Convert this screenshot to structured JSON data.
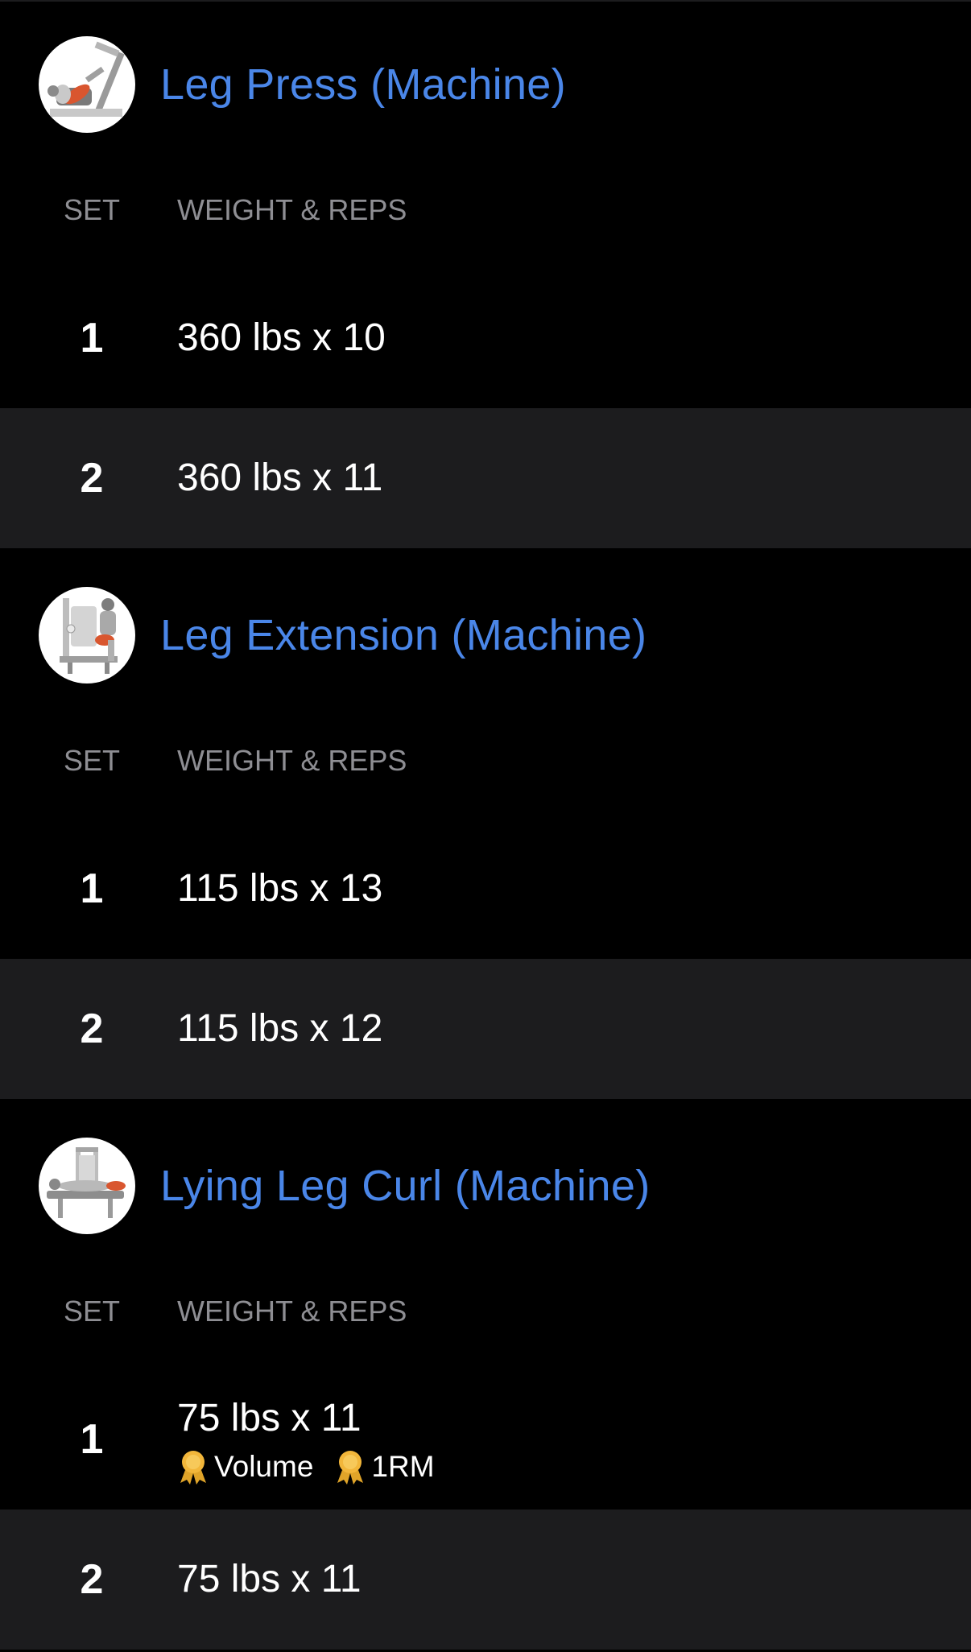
{
  "column_headers": {
    "set": "SET",
    "weight_reps": "WEIGHT & REPS"
  },
  "exercises": [
    {
      "name": "Leg Press (Machine)",
      "thumbnail_icon": "leg-press-machine-icon",
      "sets": [
        {
          "number": "1",
          "value": "360 lbs x 10"
        },
        {
          "number": "2",
          "value": "360 lbs x 11"
        }
      ]
    },
    {
      "name": "Leg Extension (Machine)",
      "thumbnail_icon": "leg-extension-machine-icon",
      "sets": [
        {
          "number": "1",
          "value": "115 lbs x 13"
        },
        {
          "number": "2",
          "value": "115 lbs x 12"
        }
      ]
    },
    {
      "name": "Lying Leg Curl (Machine)",
      "thumbnail_icon": "lying-leg-curl-machine-icon",
      "sets": [
        {
          "number": "1",
          "value": "75 lbs x 11",
          "badges": [
            {
              "icon": "medal-icon",
              "label": "Volume"
            },
            {
              "icon": "medal-icon",
              "label": "1RM"
            }
          ]
        },
        {
          "number": "2",
          "value": "75 lbs x 11"
        }
      ]
    }
  ],
  "colors": {
    "background": "#000000",
    "alt_row": "#1c1c1e",
    "accent": "#4a86e8",
    "muted_text": "#8e8e93",
    "medal": "#f2b63a"
  }
}
